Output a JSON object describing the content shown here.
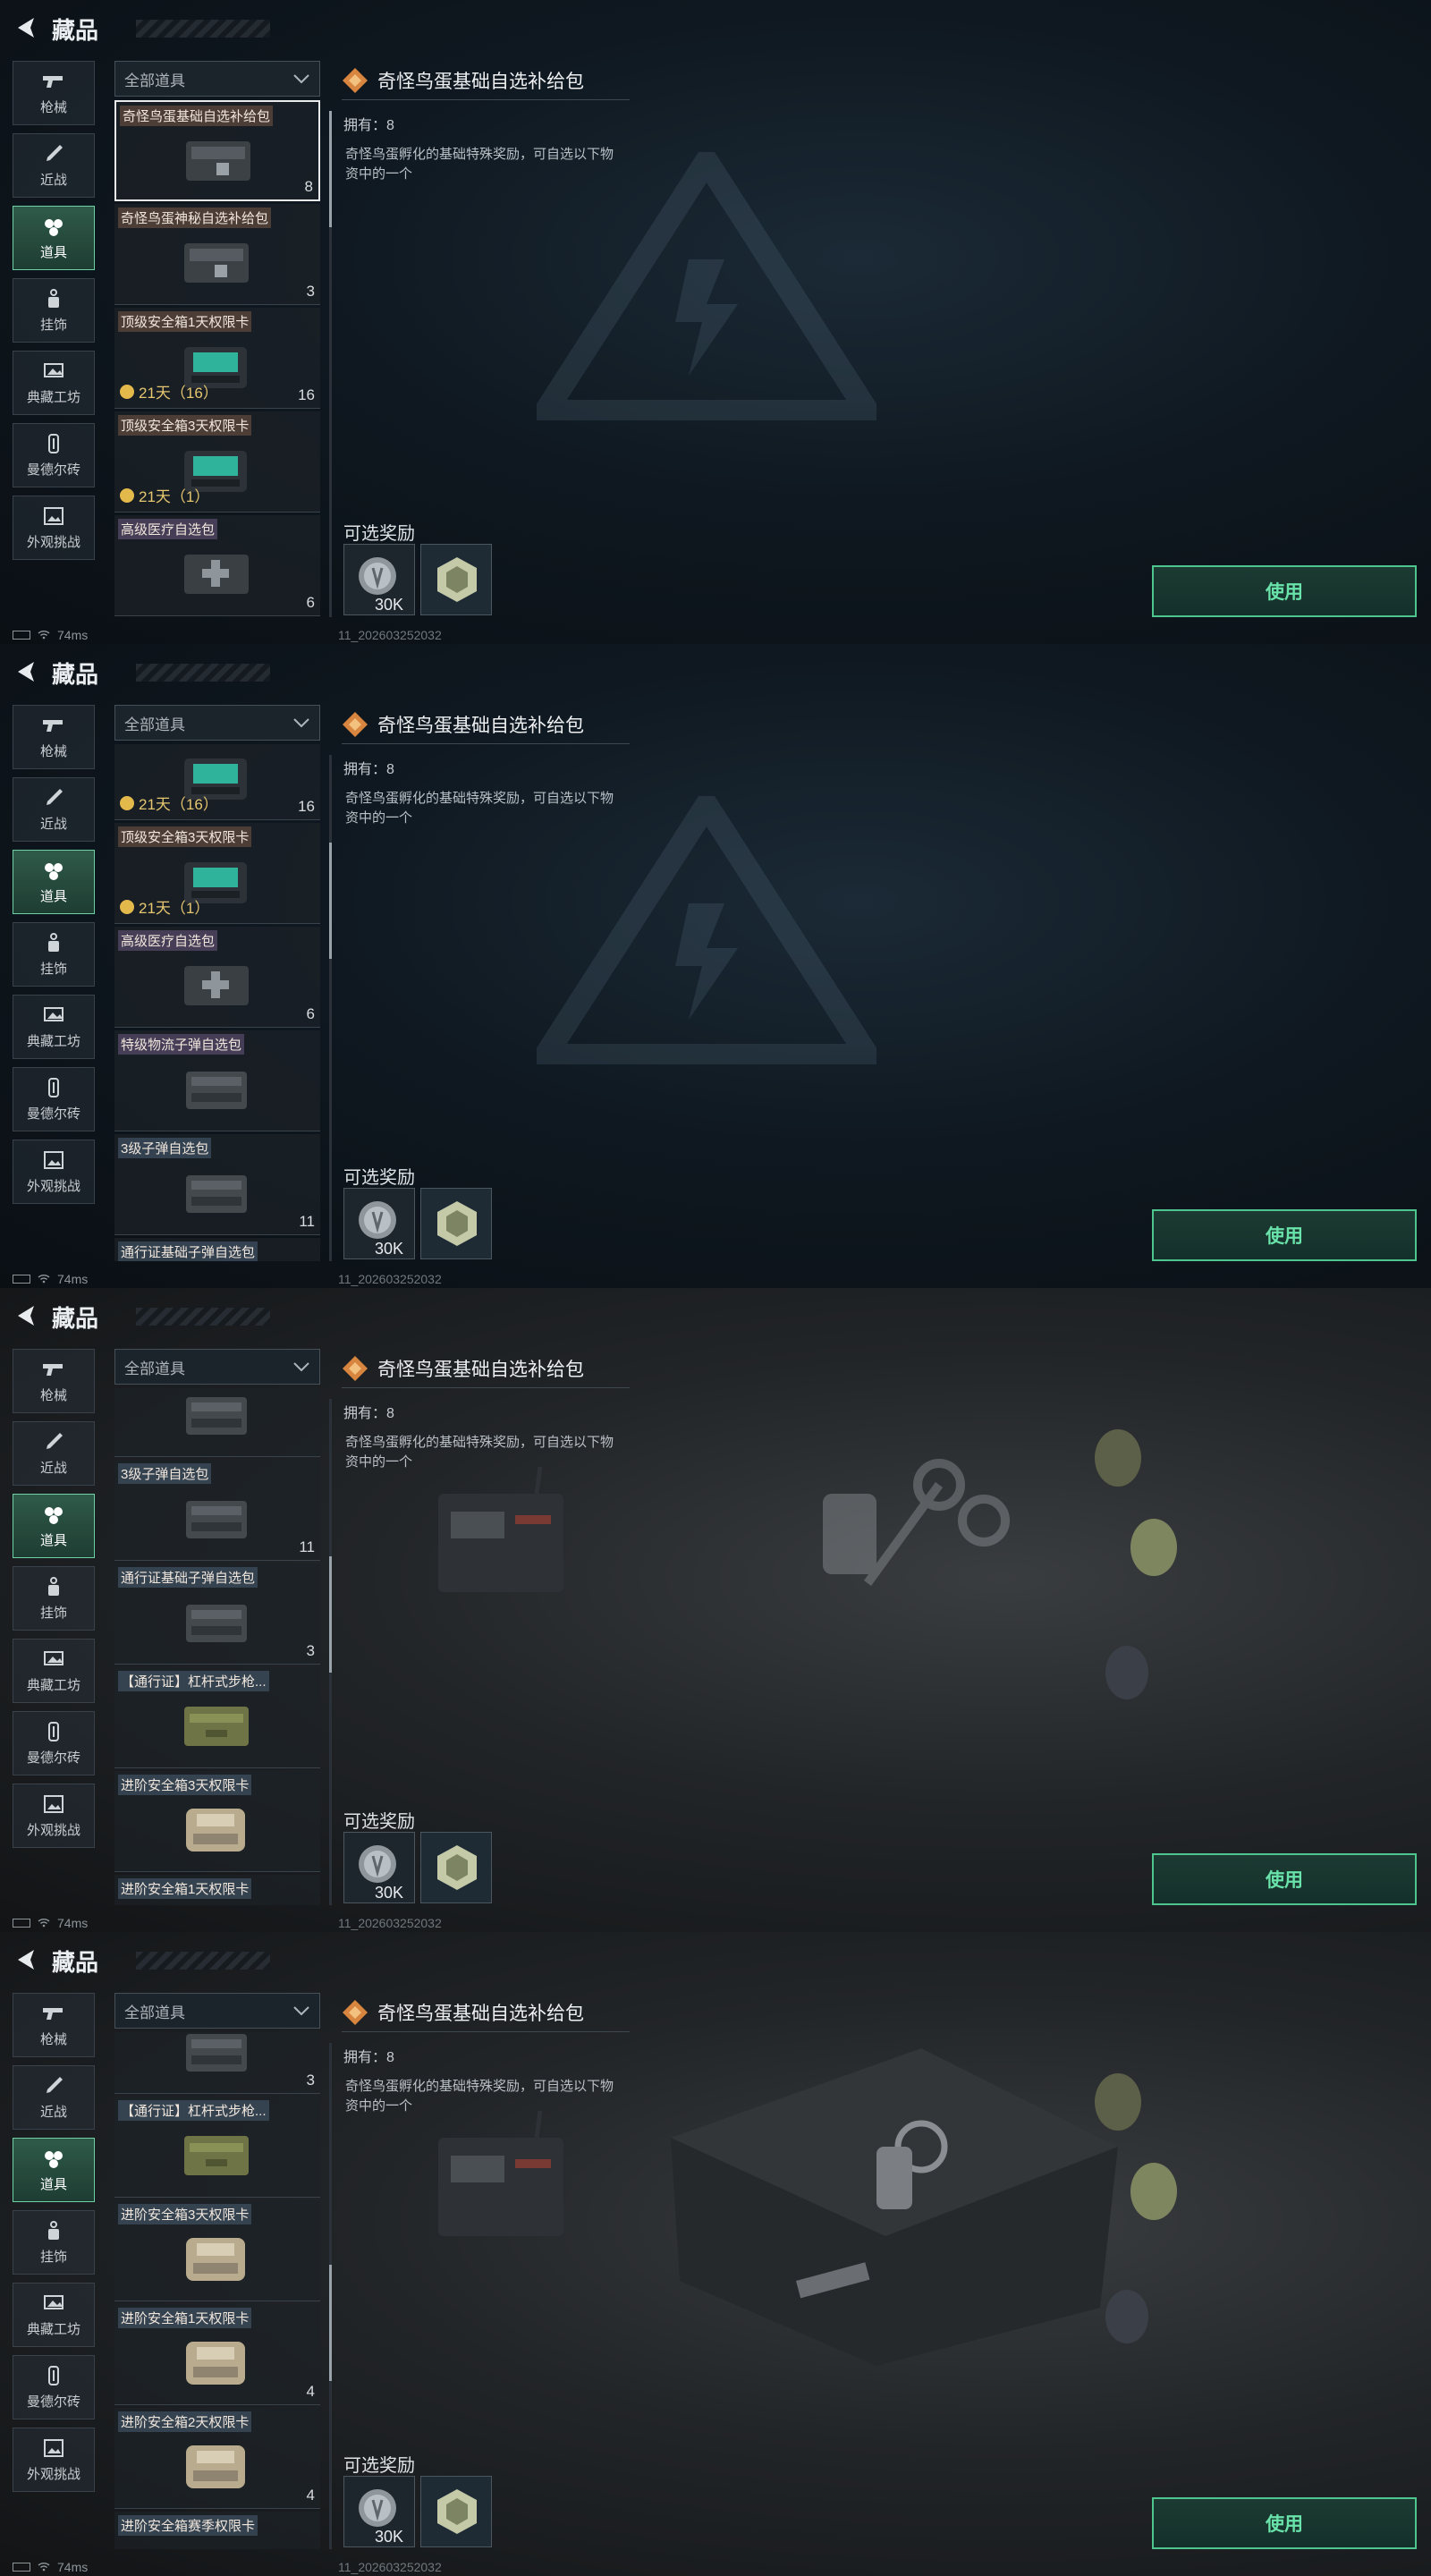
{
  "header": {
    "title": "藏品"
  },
  "categories": [
    {
      "label": "枪械",
      "icon": "gun-icon"
    },
    {
      "label": "近战",
      "icon": "knife-icon"
    },
    {
      "label": "道具",
      "icon": "items-icon",
      "active": true
    },
    {
      "label": "挂饰",
      "icon": "charm-icon"
    },
    {
      "label": "典藏工坊",
      "icon": "workshop-icon"
    },
    {
      "label": "曼德尔砖",
      "icon": "brick-icon"
    },
    {
      "label": "外观挑战",
      "icon": "appearance-icon"
    }
  ],
  "filter": {
    "label": "全部道具"
  },
  "items": [
    {
      "name": "奇怪鸟蛋基础自选补给包",
      "count": "8",
      "time": "",
      "tag": "brown",
      "icon": "supply-crate-icon"
    },
    {
      "name": "奇怪鸟蛋神秘自选补给包",
      "count": "3",
      "time": "",
      "tag": "brown",
      "icon": "supply-crate-icon"
    },
    {
      "name": "顶级安全箱1天权限卡",
      "count": "16",
      "time": "21天（16）",
      "tag": "brown",
      "icon": "safe-box-teal-icon"
    },
    {
      "name": "顶级安全箱3天权限卡",
      "count": "",
      "time": "21天（1）",
      "tag": "brown",
      "icon": "safe-box-teal-icon"
    },
    {
      "name": "高级医疗自选包",
      "count": "6",
      "time": "",
      "tag": "purple",
      "icon": "medical-crate-icon"
    },
    {
      "name": "特级物流子弹自选包",
      "count": "",
      "time": "",
      "tag": "purple",
      "icon": "ammo-crate-icon"
    },
    {
      "name": "3级子弹自选包",
      "count": "11",
      "time": "",
      "tag": "blue",
      "icon": "ammo-crate-icon"
    },
    {
      "name": "通行证基础子弹自选包",
      "count": "3",
      "time": "",
      "tag": "blue",
      "icon": "ammo-crate-icon"
    },
    {
      "name": "【通行证】杠杆式步枪...",
      "count": "",
      "time": "",
      "tag": "blue",
      "icon": "rifle-case-icon"
    },
    {
      "name": "进阶安全箱3天权限卡",
      "count": "",
      "time": "",
      "tag": "blue",
      "icon": "safe-box-tan-icon"
    },
    {
      "name": "进阶安全箱1天权限卡",
      "count": "4",
      "time": "",
      "tag": "blue",
      "icon": "safe-box-tan-icon"
    },
    {
      "name": "进阶安全箱2天权限卡",
      "count": "4",
      "time": "",
      "tag": "blue",
      "icon": "safe-box-tan-icon"
    },
    {
      "name": "进阶安全箱赛季权限卡",
      "count": "",
      "time": "",
      "tag": "blue",
      "icon": "safe-box-tan-icon"
    }
  ],
  "detail": {
    "title": "奇怪鸟蛋基础自选补给包",
    "own": "拥有：8",
    "desc": "奇怪鸟蛋孵化的基础特殊奖励，可自选以下物资中的一个",
    "rewards_label": "可选奖励",
    "coin_value": "30K",
    "use_label": "使用"
  },
  "status": {
    "ping": "74ms",
    "build": "11_202603252032"
  },
  "colors": {
    "accent": "#4ec48f",
    "active_cat": "#2f5a4a",
    "time": "#e6c770"
  }
}
